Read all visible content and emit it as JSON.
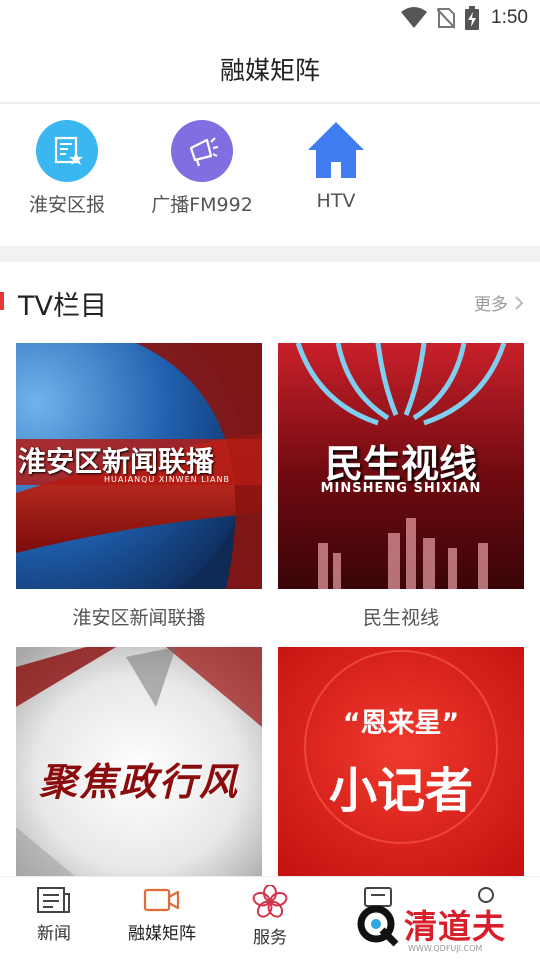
{
  "status_bar": {
    "time": "1:50",
    "icons": [
      "wifi-icon",
      "no-sim-icon",
      "battery-charging-icon"
    ]
  },
  "header": {
    "title": "融媒矩阵"
  },
  "platforms": [
    {
      "label": "淮安区报",
      "icon": "newspaper-icon",
      "color": "#3ab6f0"
    },
    {
      "label": "广播FM992",
      "icon": "megaphone-icon",
      "color": "#7f6fe0"
    },
    {
      "label": "HTV",
      "icon": "home-icon",
      "color": "#3f7cf0"
    }
  ],
  "tv_section": {
    "title": "TV栏目",
    "more_label": "更多",
    "items": [
      {
        "label": "淮安区新闻联播",
        "overlay_title": "淮安区新闻联播",
        "overlay_sub": "HUAIANQU XINWEN LIANB"
      },
      {
        "label": "民生视线",
        "overlay_title": "民生视线",
        "overlay_sub": "MINSHENG SHIXIAN"
      },
      {
        "label": "",
        "overlay_title": "聚焦政行风"
      },
      {
        "label": "",
        "overlay_quote": "“恩来星”",
        "overlay_title": "小记者"
      }
    ]
  },
  "bottom_nav": [
    {
      "label": "新闻",
      "icon": "news-icon",
      "active": false
    },
    {
      "label": "融媒矩阵",
      "icon": "video-camera-icon",
      "active": true
    },
    {
      "label": "服务",
      "icon": "flower-icon",
      "active": false
    },
    {
      "label": "",
      "icon": "chat-icon",
      "active": false
    },
    {
      "label": "",
      "icon": "user-icon",
      "active": false
    }
  ],
  "watermark": {
    "text": "清道夫",
    "sub": "WWW.QDFUJI.COM"
  },
  "colors": {
    "accent_red": "#e53935",
    "nav_active": "#e06c3a"
  }
}
